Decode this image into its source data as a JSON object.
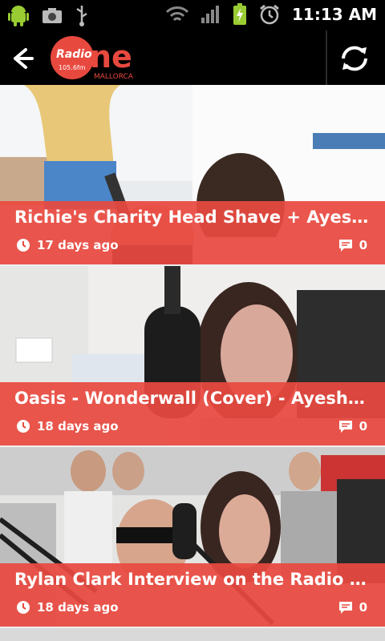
{
  "status_bar": {
    "time": "11:13 AM",
    "icons": [
      "android-icon",
      "camera-icon",
      "usb-icon",
      "wifi-icon",
      "signal-icon",
      "battery-charging-icon",
      "alarm-icon"
    ]
  },
  "action_bar": {
    "logo_word": "Radio",
    "logo_brand": "ne",
    "logo_freq": "105.6fm",
    "logo_region": "MALLORCA"
  },
  "feed": {
    "items": [
      {
        "title": "Richie's Charity Head Shave + Ayesha r...",
        "age": "17 days ago",
        "comments": "0"
      },
      {
        "title": "Oasis - Wonderwall (Cover) - Ayesha fr...",
        "age": "18 days ago",
        "comments": "0"
      },
      {
        "title": "Rylan Clark Interview on the Radio On...",
        "age": "18 days ago",
        "comments": "0"
      }
    ]
  },
  "colors": {
    "accent": "#e8493f",
    "bar": "#000000"
  }
}
